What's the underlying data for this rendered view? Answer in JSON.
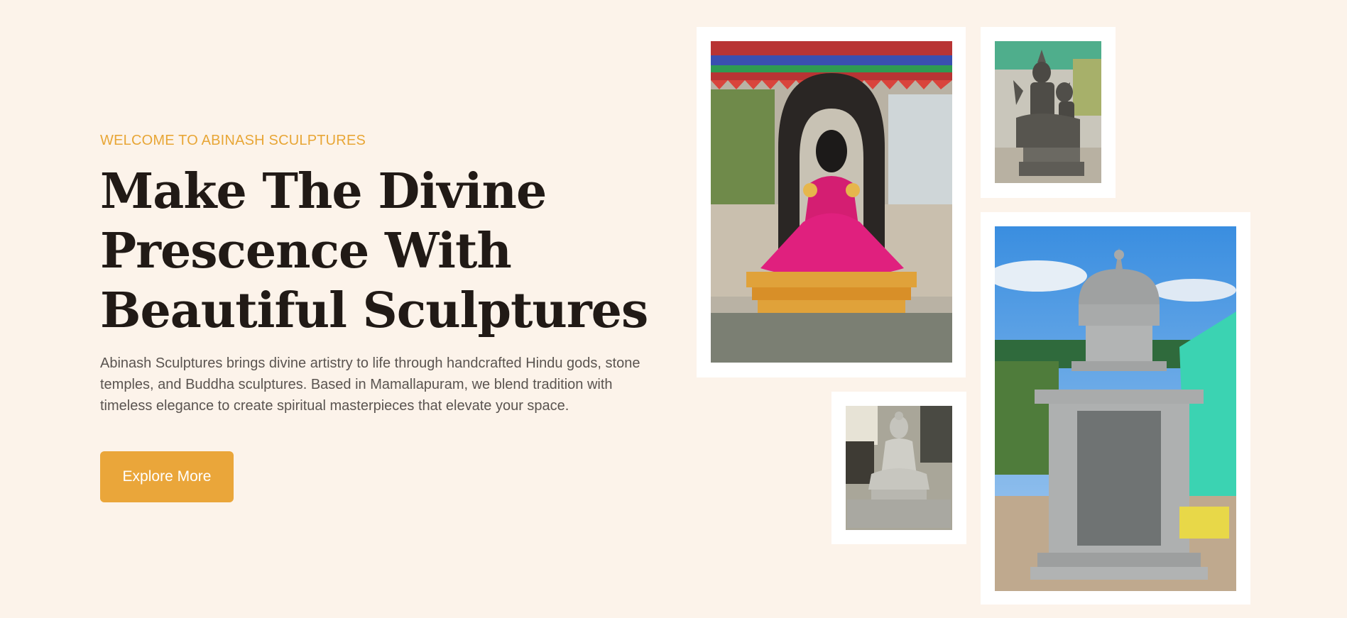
{
  "hero": {
    "eyebrow": "WELCOME TO ABINASH SCULPTURES",
    "headline_lines": [
      "Make The Divine",
      "Prescence With",
      "Beautiful Sculptures"
    ],
    "description": "Abinash Sculptures brings divine artistry to life through handcrafted Hindu gods, stone temples, and Buddha sculptures. Based in Mamallapuram, we blend tradition with timeless elegance to create spiritual masterpieces that elevate your space.",
    "cta_label": "Explore More"
  },
  "gallery": {
    "images": [
      {
        "name": "goddess-statue-photo"
      },
      {
        "name": "stone-deity-photo"
      },
      {
        "name": "buddha-statue-photo"
      },
      {
        "name": "stone-temple-photo"
      }
    ]
  },
  "colors": {
    "background": "#fcf3ea",
    "accent": "#eaa63a",
    "heading": "#211a16",
    "body_text": "#5a5450"
  }
}
